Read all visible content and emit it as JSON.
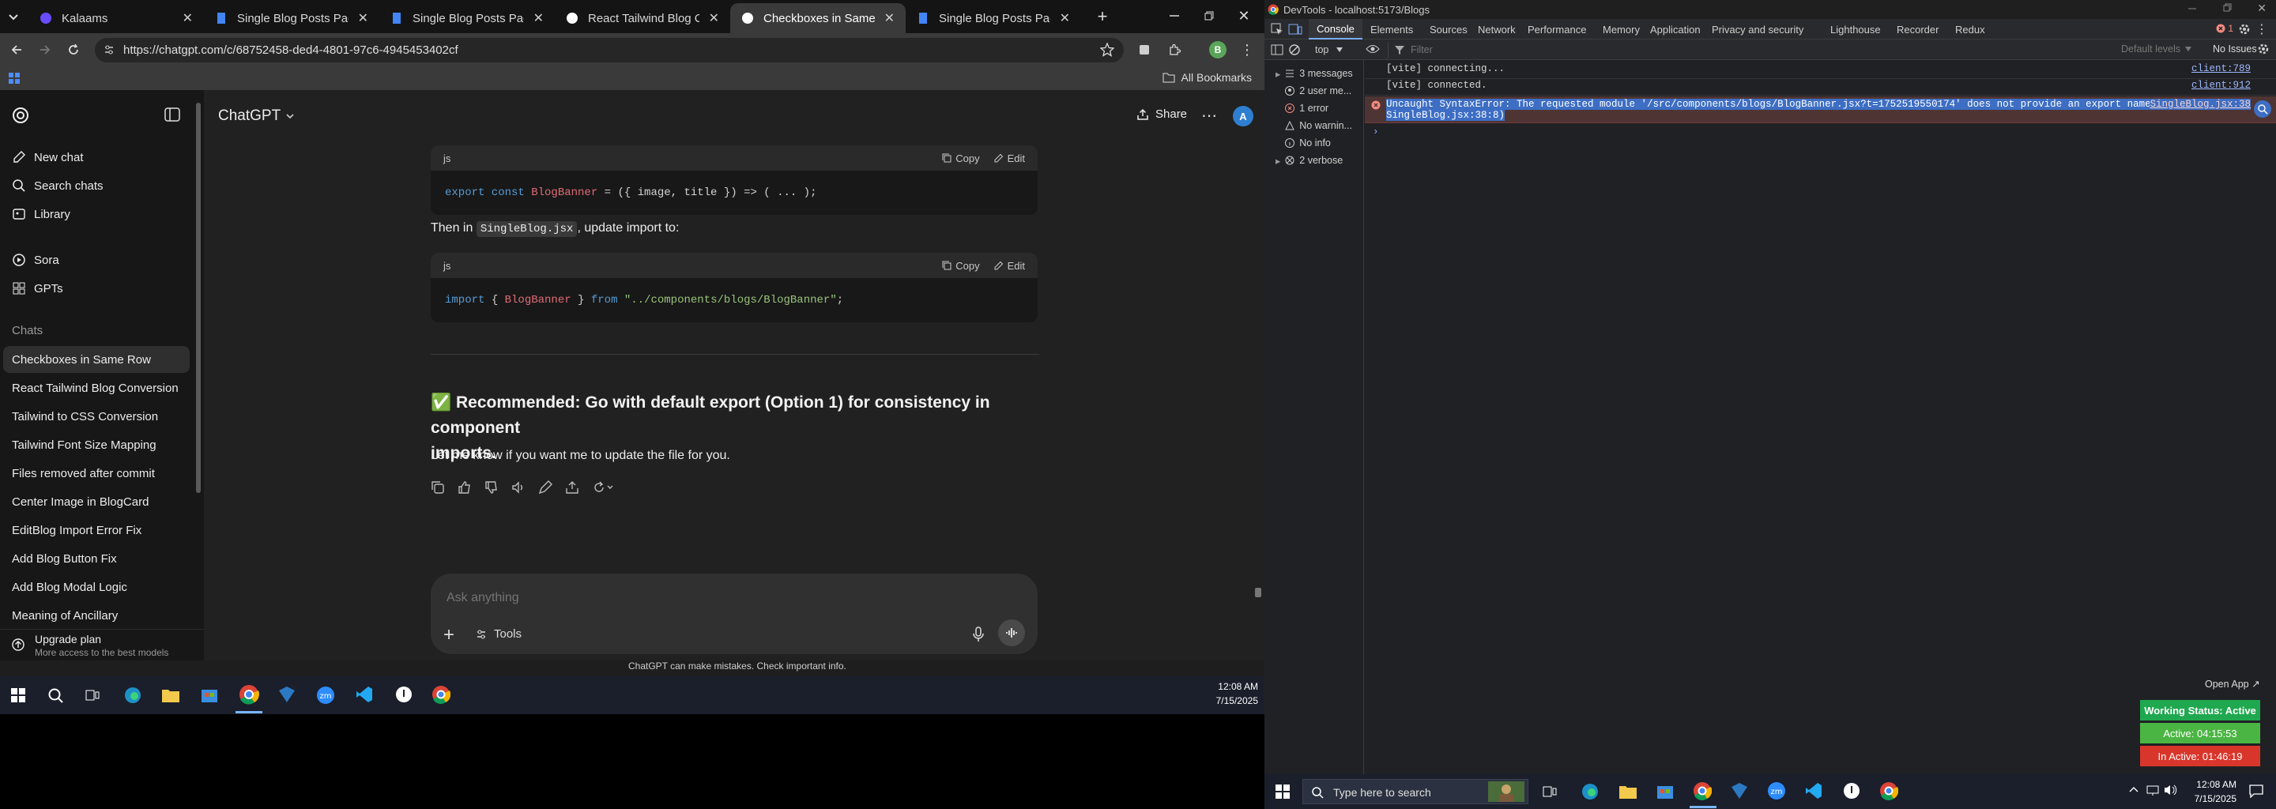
{
  "browser": {
    "tabs": [
      {
        "title": "Kalaams"
      },
      {
        "title": "Single Blog Posts Page Desig"
      },
      {
        "title": "Single Blog Posts Page Desig"
      },
      {
        "title": "React Tailwind Blog Convers"
      },
      {
        "title": "Checkboxes in Same Row"
      },
      {
        "title": "Single Blog Posts Page Desig"
      }
    ],
    "url": "https://chatgpt.com/c/68752458-ded4-4801-97c6-4945453402cf",
    "bookmarks_label": "All Bookmarks",
    "profile_letter": "B"
  },
  "sidebar": {
    "top_items": [
      {
        "label": "New chat",
        "icon": "new-chat-icon"
      },
      {
        "label": "Search chats",
        "icon": "search-icon"
      },
      {
        "label": "Library",
        "icon": "library-icon"
      },
      {
        "label": "Sora",
        "icon": "sora-icon"
      },
      {
        "label": "GPTs",
        "icon": "gpts-icon"
      }
    ],
    "chats_heading": "Chats",
    "chats": [
      "Checkboxes in Same Row",
      "React Tailwind Blog Conversion",
      "Tailwind to CSS Conversion",
      "Tailwind Font Size Mapping",
      "Files removed after commit",
      "Center Image in BlogCard",
      "EditBlog Import Error Fix",
      "Add Blog Button Fix",
      "Add Blog Modal Logic",
      "Meaning of Ancillary"
    ],
    "upgrade_title": "Upgrade plan",
    "upgrade_subtitle": "More access to the best models"
  },
  "header": {
    "model": "ChatGPT",
    "share_label": "Share",
    "avatar_letter": "A"
  },
  "message": {
    "code1": {
      "lang": "js",
      "copy": "Copy",
      "edit": "Edit",
      "parts": [
        "export const ",
        "BlogBanner",
        " = ({ image, title }) => ( ... );"
      ]
    },
    "then_prefix": "Then in ",
    "then_code": "SingleBlog.jsx",
    "then_suffix": ", update import to:",
    "code2": {
      "lang": "js",
      "copy": "Copy",
      "edit": "Edit",
      "parts": [
        "import ",
        "{ ",
        "BlogBanner",
        " } ",
        "from ",
        "\"../components/blogs/BlogBanner\"",
        ";"
      ]
    },
    "rec_check": "✅",
    "rec_a": "Recommended: Go with ",
    "rec_b": "default export",
    "rec_c": " (Option 1) for consistency in component",
    "rec_d": "imports.",
    "followup": "Let me know if you want me to update the file for you."
  },
  "composer": {
    "placeholder": "Ask anything",
    "tools_label": "Tools",
    "disclaimer": "ChatGPT can make mistakes. Check important info."
  },
  "taskbar_left": {
    "time": "12:08 AM",
    "date": "7/15/2025"
  },
  "devtools": {
    "title": "DevTools - localhost:5173/Blogs",
    "tabs": [
      "Console",
      "Elements",
      "Sources",
      "Network",
      "Performance",
      "Memory",
      "Application",
      "Privacy and security",
      "Lighthouse",
      "Recorder",
      "Redux"
    ],
    "error_badge": "1",
    "context": "top",
    "filter_placeholder": "Filter",
    "levels": "Default levels",
    "issues": "No Issues",
    "side_items": [
      {
        "label": "3 messages",
        "icon": "messages-icon"
      },
      {
        "label": "2 user me...",
        "icon": "user-icon"
      },
      {
        "label": "1 error",
        "icon": "error-icon"
      },
      {
        "label": "No warnin...",
        "icon": "warning-icon"
      },
      {
        "label": "No info",
        "icon": "info-icon"
      },
      {
        "label": "2 verbose",
        "icon": "verbose-icon"
      }
    ],
    "console": [
      {
        "text": "[vite] connecting...",
        "src": "client:789"
      },
      {
        "text": "[vite] connected.",
        "src": "client:912"
      }
    ],
    "error_line1": "Uncaught SyntaxError: The requested module '/src/components/blogs/BlogBanner.jsx?t=1752519550174' does not provide an export named 'default' (at",
    "error_line2": "SingleBlog.jsx:38:8)",
    "error_src": "SingleBlog.jsx:38",
    "prompt": "›"
  },
  "widget": {
    "open_app": "Open App ↗",
    "working": "Working Status: Active",
    "active": "Active: 04:15:53",
    "inactive": "In Active: 01:46:19"
  },
  "taskbar_right": {
    "search_placeholder": "Type here to search",
    "time": "12:08 AM",
    "date": "7/15/2025"
  }
}
